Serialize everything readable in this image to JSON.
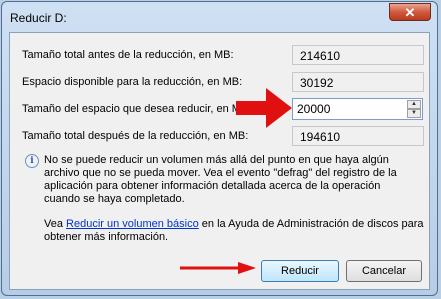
{
  "window": {
    "title": "Reducir D:",
    "close_label": "✕"
  },
  "fields": [
    {
      "label": "Tamaño total antes de la reducción, en MB:",
      "value": "214610"
    },
    {
      "label": "Espacio disponible para la reducción, en MB:",
      "value": "30192"
    },
    {
      "label": "Tamaño del espacio que desea reducir, en MB:",
      "value": "20000"
    },
    {
      "label": "Tamaño total después de la reducción, en MB:",
      "value": "194610"
    }
  ],
  "info": {
    "icon": "info-icon",
    "text": "No se puede reducir un volumen más allá del punto en que haya algún archivo que no se pueda mover. Vea el evento \"defrag\" del registro de la aplicación para obtener información detallada acerca de la operación cuando se haya completado."
  },
  "see": {
    "prefix": "Vea ",
    "link": "Reducir un volumen básico",
    "suffix": " en la Ayuda de Administración de discos para obtener más información."
  },
  "buttons": {
    "primary": "Reducir",
    "cancel": "Cancelar"
  },
  "colors": {
    "annotation_arrow": "#e01010",
    "link": "#0033cc"
  }
}
